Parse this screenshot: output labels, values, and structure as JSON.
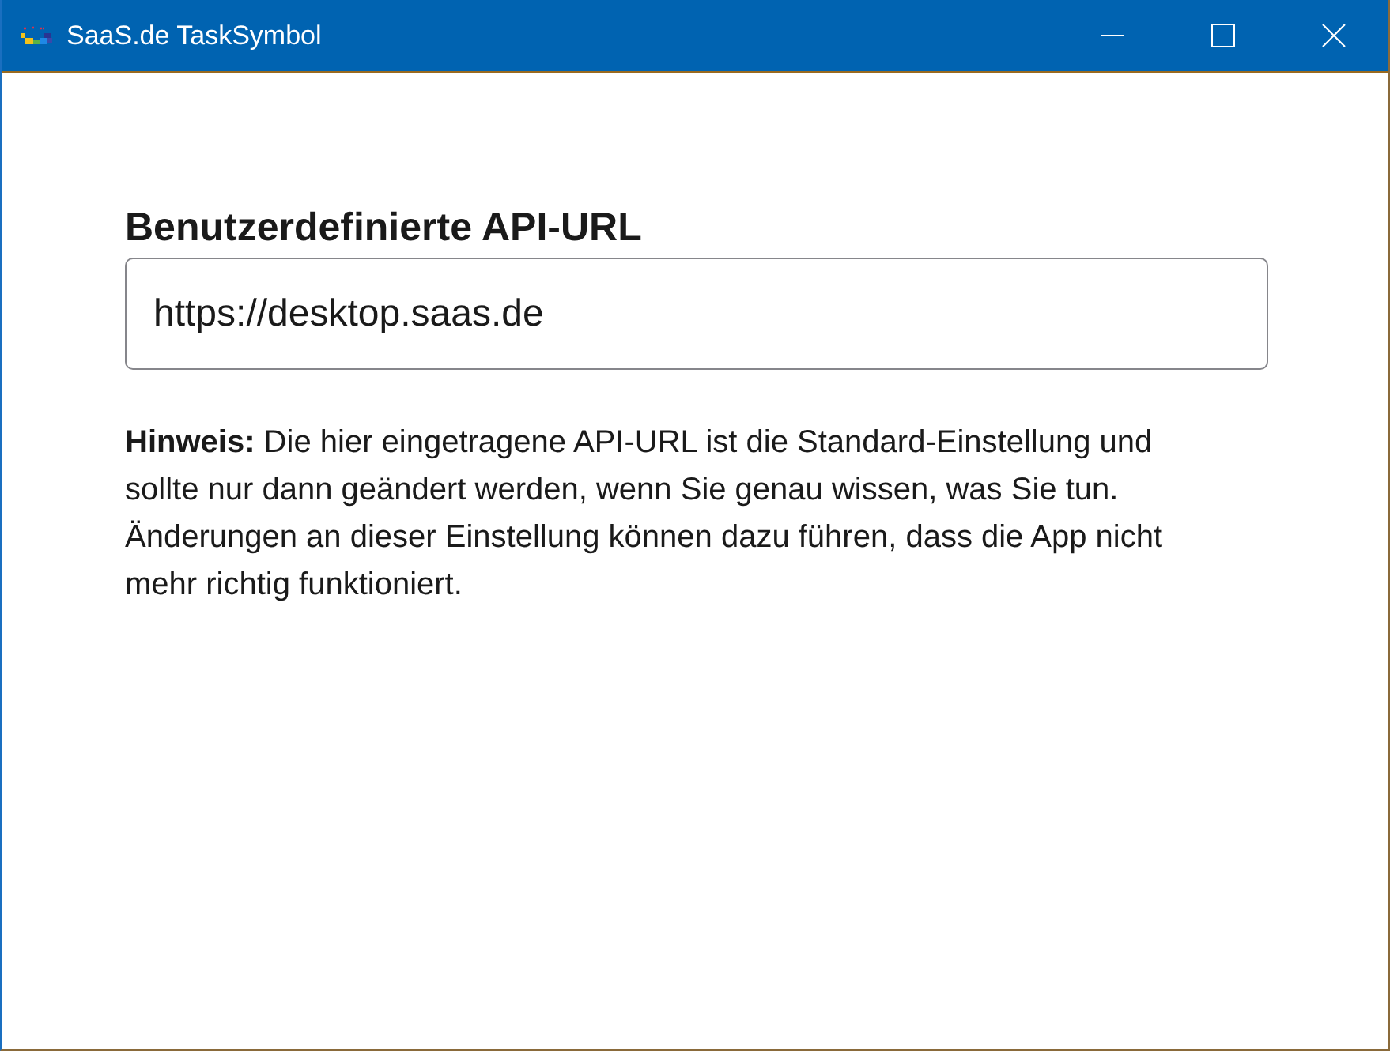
{
  "window": {
    "title": "SaaS.de TaskSymbol"
  },
  "form": {
    "label": "Benutzerdefinierte API-URL",
    "input": {
      "value": "https://desktop.saas.de"
    }
  },
  "note": {
    "text": "**Hinweis:** Die hier eingetragene API-URL ist die Standard-Einstellung und sollte nur dann geändert werden, wenn Sie genau wissen, was Sie tun. Änderungen an dieser Einstellung können dazu führen, dass die App nicht mehr richtig funktioniert."
  }
}
